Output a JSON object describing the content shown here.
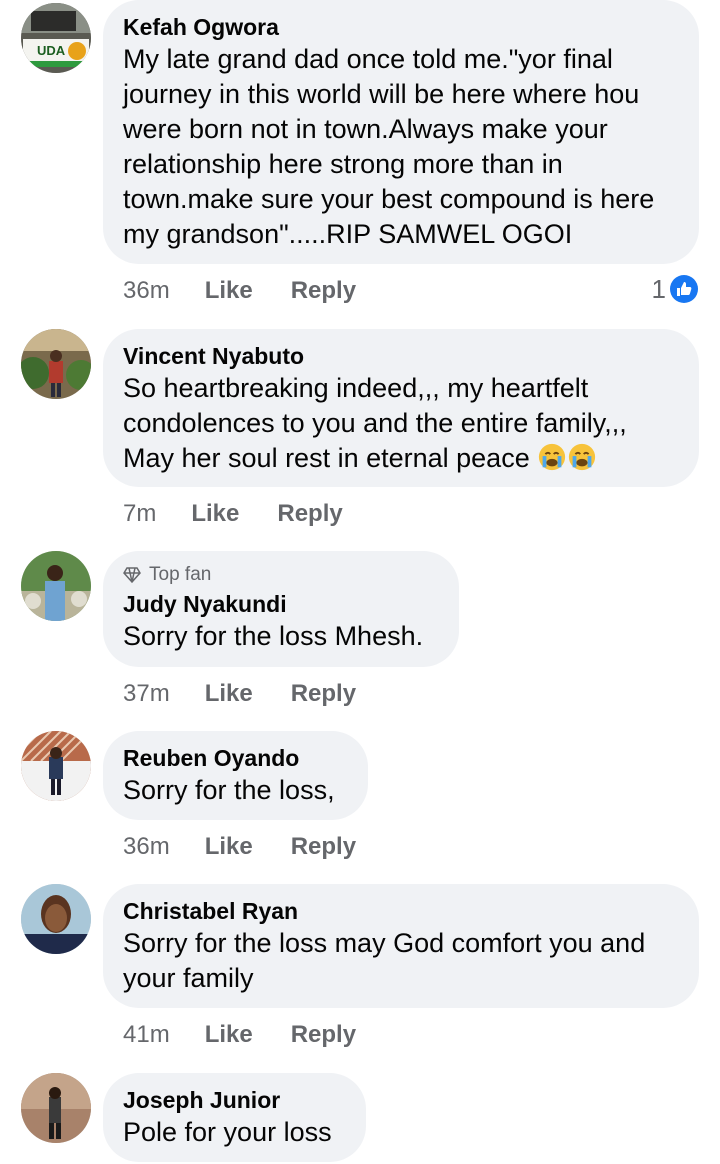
{
  "comments": [
    {
      "author": "Kefah Ogwora",
      "text": "My late grand dad once told me.\"yor final\njourney in this world will be here where hou\nwere born not in town.Always make your\nrelationship here strong more than in\ntown.make sure your best compound is here\nmy grandson\".....RIP SAMWEL OGOI",
      "time": "36m",
      "like_label": "Like",
      "reply_label": "Reply",
      "reaction_count": "1",
      "avatar_text": "UDA"
    },
    {
      "author": "Vincent Nyabuto",
      "text": "So heartbreaking indeed,,, my heartfelt\ncondolences to you and the entire family,,,\nMay her soul rest in eternal peace",
      "emojis": [
        "crying-face",
        "crying-face"
      ],
      "time": "7m",
      "like_label": "Like",
      "reply_label": "Reply"
    },
    {
      "badge": "Top fan",
      "author": "Judy Nyakundi",
      "text": "Sorry for the loss Mhesh.",
      "time": "37m",
      "like_label": "Like",
      "reply_label": "Reply"
    },
    {
      "author": "Reuben Oyando",
      "text": "Sorry for the loss,",
      "time": "36m",
      "like_label": "Like",
      "reply_label": "Reply"
    },
    {
      "author": "Christabel Ryan",
      "text": "Sorry for the loss may God comfort you and\nyour family",
      "time": "41m",
      "like_label": "Like",
      "reply_label": "Reply"
    },
    {
      "author": "Joseph Junior",
      "text": "Pole for your loss"
    }
  ],
  "colors": {
    "bubble": "#f0f2f5",
    "meta": "#65676b",
    "like_badge": "#1877f2"
  }
}
